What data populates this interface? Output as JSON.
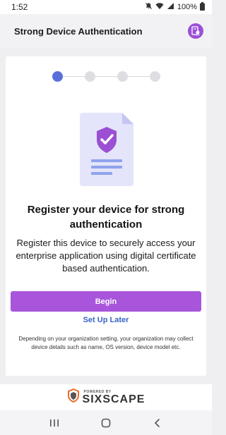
{
  "status_bar": {
    "time": "1:52",
    "battery": "100%"
  },
  "app_bar": {
    "title": "Strong Device Authentication",
    "icon": "certificate-badge-icon"
  },
  "stepper": {
    "total_steps": 4,
    "current_step": 1
  },
  "illustration": {
    "icon": "shield-check-document-icon"
  },
  "content": {
    "heading": "Register your device for strong authentication",
    "description": "Register this device to securely access your enterprise application using digital certificate based authentication.",
    "begin_label": "Begin",
    "setup_later_label": "Set Up Later",
    "disclaimer": "Depending on your organization setting, your organization may collect device details such as name, OS version, device model etc."
  },
  "footer": {
    "powered_by": "POWERED BY",
    "brand": "SIXSCAPE"
  },
  "colors": {
    "accent": "#a855dc",
    "active_step": "#5a6fdc",
    "link": "#3a64c8"
  }
}
